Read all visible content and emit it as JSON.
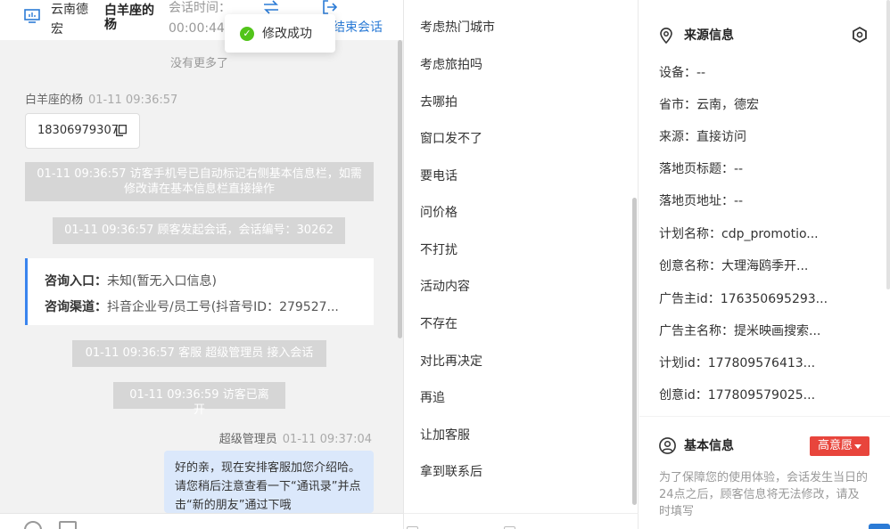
{
  "chat": {
    "header": {
      "location": "云南德宏",
      "visitor_name": "白羊座的杨",
      "time_label": "会话时间：",
      "time_value": "00:00:44",
      "end_label": "结束会话"
    },
    "toast": "修改成功",
    "no_more": "没有更多了",
    "visitor_msg": {
      "sender": "白羊座的杨",
      "time": "01-11 09:36:57",
      "content": "18306979307"
    },
    "system_msgs": [
      "01-11 09:36:57 访客手机号已自动标记右侧基本信息栏，如需修改请在基本信息栏直接操作",
      "01-11 09:36:57 顾客发起会话，会话编号：30262",
      "01-11 09:36:57 客服 超级管理员 接入会话",
      "01-11 09:36:59 访客已离开"
    ],
    "consult": {
      "entry_label": "咨询入口：",
      "entry_value": "未知(暂无入口信息)",
      "channel_label": "咨询渠道：",
      "channel_value": "抖音企业号/员工号(抖音号ID：279527..."
    },
    "agent_msg": {
      "sender": "超级管理员",
      "time": "01-11 09:37:04",
      "content": "好的亲，现在安排客服加您介绍哈。请您稍后注意查看一下“通讯录”并点击“新的朋友”通过下哦"
    }
  },
  "quick_replies": [
    "考虑热门城市",
    "考虑旅拍吗",
    "去哪拍",
    "窗口发不了",
    "要电话",
    "问价格",
    "不打扰",
    "活动内容",
    "不存在",
    "对比再决定",
    "再追",
    "让加客服",
    "拿到联系后"
  ],
  "info": {
    "source_title": "来源信息",
    "source_rows": [
      "设备：--",
      "省市：云南，德宏",
      "来源：直接访问",
      "落地页标题：--",
      "落地页地址：--",
      "计划名称：cdp_promotio...",
      "创意名称：大理海鸥季开...",
      "广告主id：176350695293...",
      "广告主名称：提米映画搜索...",
      "计划id：177809576413...",
      "创意id：177809579025..."
    ],
    "basic_title": "基本信息",
    "intent_badge": "高意愿",
    "note": "为了保障您的使用体验，会话发生当日的24点之后，顾客信息将无法修改，请及时填写"
  },
  "colors": {
    "accent": "#2b7bd6",
    "success": "#52c41a",
    "badge_red": "#e8453c",
    "agent_bubble": "#dbe8fb"
  }
}
